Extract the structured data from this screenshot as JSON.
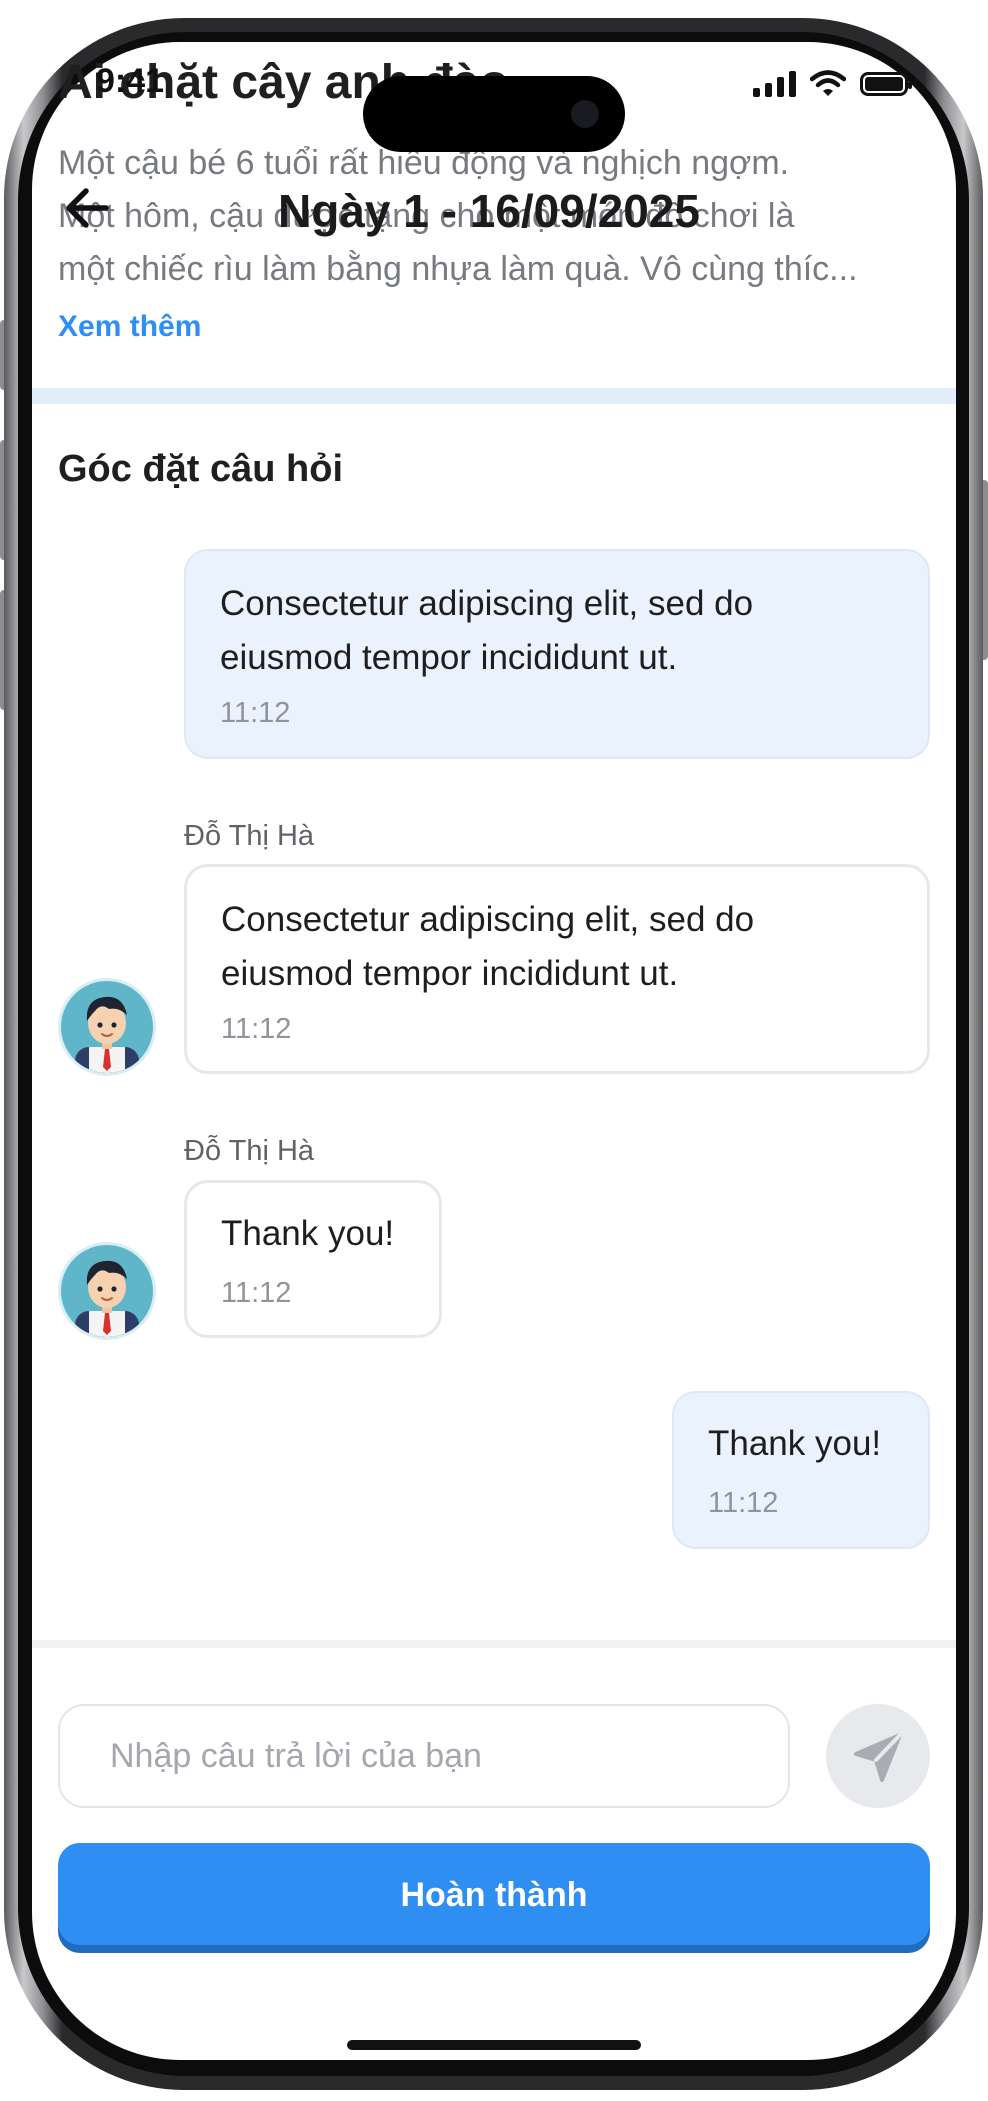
{
  "status_bar": {
    "time": "9:41"
  },
  "story": {
    "title": "Ai chặt cây anh đào",
    "text_lines": [
      "Một cậu bé 6 tuổi rất hiếu động và nghịch ngợm.",
      "Một hôm, cậu được tặng cho một món đồ chơi là",
      "một chiếc rìu làm bằng nhựa làm quà. Vô cùng thíc..."
    ],
    "see_more": "Xem thêm"
  },
  "nav": {
    "title": "Ngày 1 - 16/09/2025",
    "back_icon": "arrow-left-icon"
  },
  "section_title": "Góc đặt câu hỏi",
  "messages": [
    {
      "from": "me",
      "text": "Consectetur adipiscing elit, sed do eiusmod tempor incididunt ut.",
      "time": "11:12"
    },
    {
      "from": "other",
      "sender": "Đỗ Thị Hà",
      "text": "Consectetur adipiscing elit, sed do eiusmod tempor incididunt ut.",
      "time": "11:12"
    },
    {
      "from": "other",
      "sender": "Đỗ Thị Hà",
      "text": "Thank you!",
      "time": "11:12"
    },
    {
      "from": "me",
      "text": "Thank you!",
      "time": "11:12"
    }
  ],
  "composer": {
    "placeholder": "Nhập câu trả lời của bạn",
    "value": "",
    "send_icon": "send-icon"
  },
  "done_label": "Hoàn thành",
  "colors": {
    "accent": "#2f8ef2",
    "my_bubble": "#eaf2fd",
    "avatar_bg": "#5fb6c8"
  }
}
